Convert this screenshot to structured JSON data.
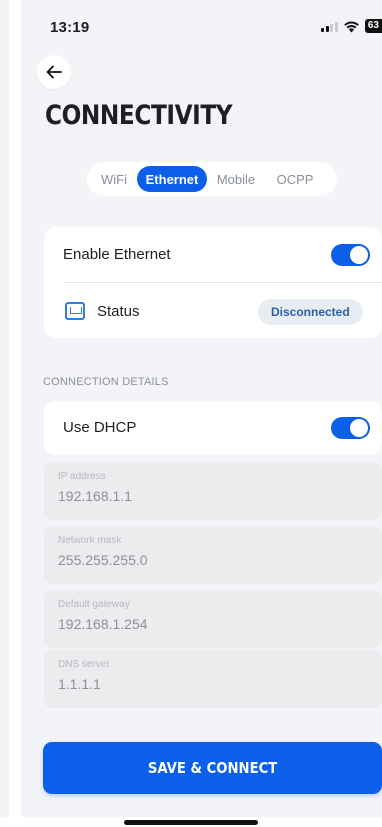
{
  "status_bar": {
    "time": "13:19",
    "battery": "63"
  },
  "header": {
    "title": "CONNECTIVITY"
  },
  "tabs": [
    {
      "label": "WiFi",
      "selected": false
    },
    {
      "label": "Ethernet",
      "selected": true
    },
    {
      "label": "Mobile",
      "selected": false
    },
    {
      "label": "OCPP",
      "selected": false
    }
  ],
  "ethernet_card": {
    "enable_label": "Enable Ethernet",
    "enable_on": true,
    "status_label": "Status",
    "status_value": "Disconnected"
  },
  "details": {
    "section_title": "CONNECTION DETAILS",
    "dhcp_label": "Use DHCP",
    "dhcp_on": true,
    "fields": [
      {
        "label": "IP address",
        "value": "192.168.1.1"
      },
      {
        "label": "Network mask",
        "value": "255.255.255.0"
      },
      {
        "label": "Default gateway",
        "value": "192.168.1.254"
      },
      {
        "label": "DNS server",
        "value": "1.1.1.1"
      }
    ]
  },
  "actions": {
    "save_label": "SAVE & CONNECT"
  },
  "colors": {
    "accent": "#0b5fe8",
    "background": "#f3f4f7",
    "badge_bg": "#e8ecf3"
  }
}
